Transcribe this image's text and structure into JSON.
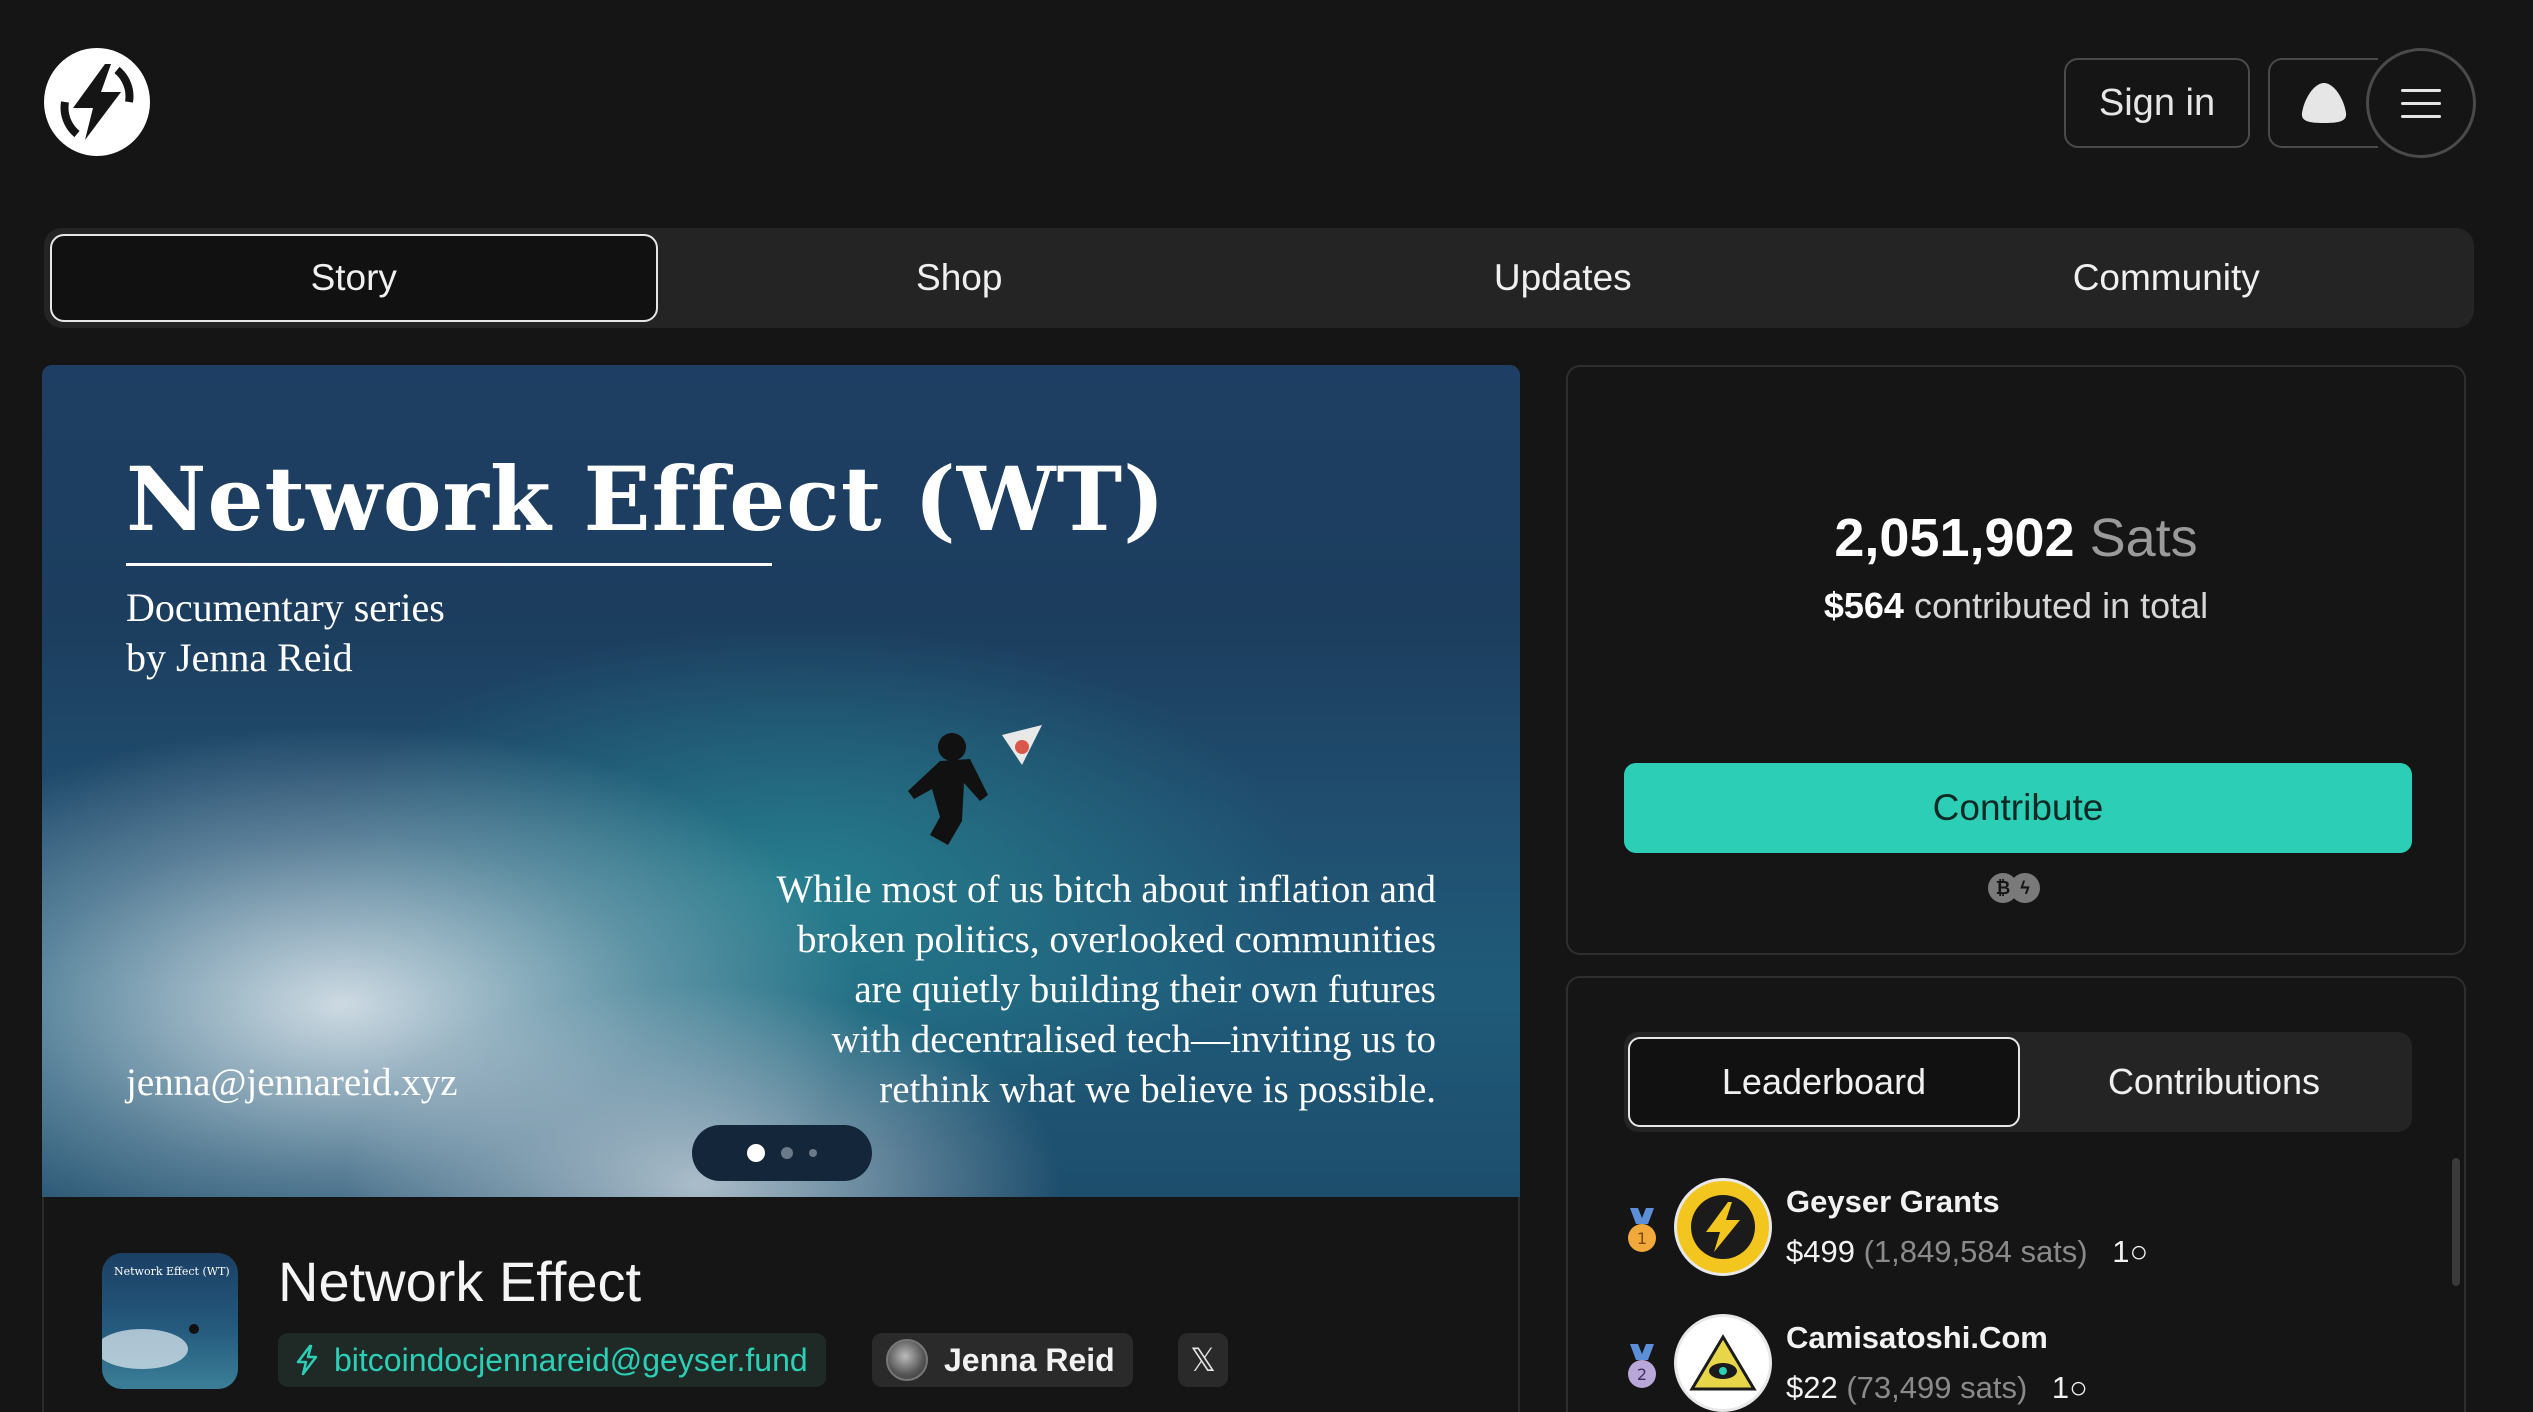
{
  "header": {
    "logo_icon": "geyser-bolt-logo-icon",
    "signin_label": "Sign in",
    "nostr_icon": "nostr-ostrich-icon",
    "menu_icon": "hamburger-menu-icon"
  },
  "tabs": [
    {
      "label": "Story",
      "active": true
    },
    {
      "label": "Shop",
      "active": false
    },
    {
      "label": "Updates",
      "active": false
    },
    {
      "label": "Community",
      "active": false
    }
  ],
  "hero": {
    "title": "Network Effect (WT)",
    "subtitle_line1": "Documentary series",
    "subtitle_line2": "by Jenna Reid",
    "quote": "While most of us bitch about inflation and\nbroken politics, overlooked communities\nare quietly building their own futures\nwith decentralised tech—inviting us to\nrethink what we believe is possible.",
    "email": "jenna@jennareid.xyz",
    "carousel": {
      "count": 3,
      "active_index": 0
    }
  },
  "project": {
    "thumb_title": "Network Effect (WT)",
    "name": "Network Effect",
    "lightning_address": "bitcoindocjennareid@geyser.fund",
    "creator_name": "Jenna Reid",
    "x_icon": "x-logo-icon"
  },
  "funding": {
    "sats_amount": "2,051,902",
    "sats_unit": "Sats",
    "usd_amount": "$564",
    "usd_suffix": "contributed in total",
    "contribute_label": "Contribute",
    "payment_icons": [
      "bitcoin-icon",
      "lightning-icon"
    ],
    "accent_color": "#2ccfb6"
  },
  "leaderboard": {
    "tabs": [
      {
        "label": "Leaderboard",
        "active": true
      },
      {
        "label": "Contributions",
        "active": false
      }
    ],
    "rows": [
      {
        "rank": "1",
        "name": "Geyser Grants",
        "usd": "$499",
        "sats": "(1,849,584 sats)",
        "count": "1"
      },
      {
        "rank": "2",
        "name": "Camisatoshi.Com",
        "usd": "$22",
        "sats": "(73,499 sats)",
        "count": "1"
      }
    ]
  }
}
